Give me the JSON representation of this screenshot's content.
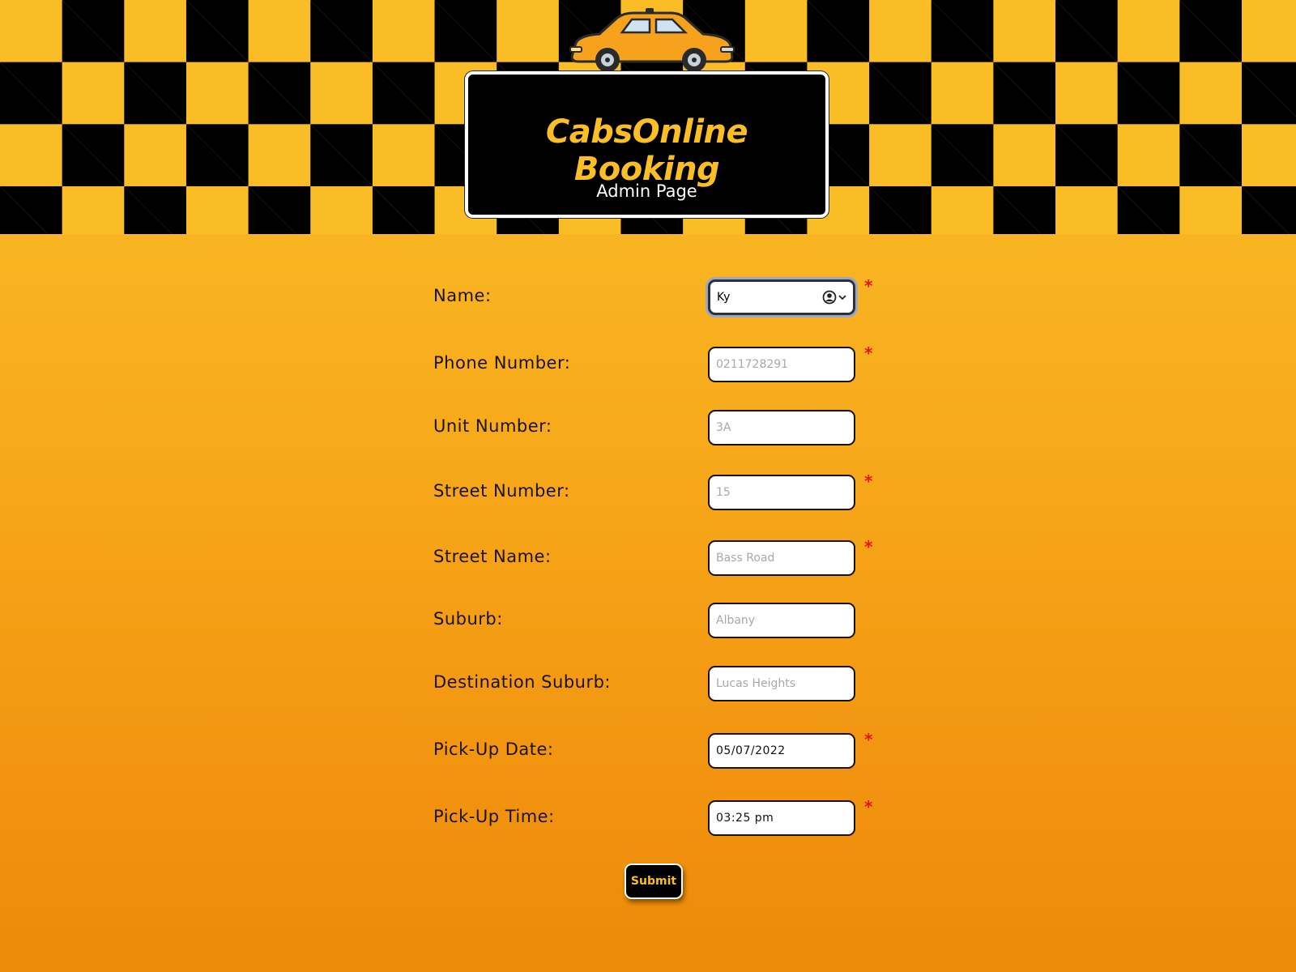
{
  "header": {
    "title": "CabsOnline Booking",
    "subtitle": "Admin Page"
  },
  "colors": {
    "accent": "#fbbf25",
    "required": "#e8141a",
    "background_top": "#fcc22a",
    "background_bottom": "#ec8a0a"
  },
  "icons": {
    "logo": "taxi-car-icon",
    "autofill": "contact-autofill-icon",
    "required_marker": "asterisk"
  },
  "form": {
    "required_marker": "*",
    "fields": [
      {
        "key": "name",
        "label": "Name:",
        "value": "Ky",
        "placeholder": "",
        "required": true,
        "focused": true
      },
      {
        "key": "phone",
        "label": "Phone Number:",
        "value": "",
        "placeholder": "0211728291",
        "required": true
      },
      {
        "key": "unit",
        "label": "Unit Number:",
        "value": "",
        "placeholder": "3A",
        "required": false
      },
      {
        "key": "street_number",
        "label": "Street Number:",
        "value": "",
        "placeholder": "15",
        "required": true
      },
      {
        "key": "street_name",
        "label": "Street Name:",
        "value": "",
        "placeholder": "Bass Road",
        "required": true
      },
      {
        "key": "suburb",
        "label": "Suburb:",
        "value": "",
        "placeholder": "Albany",
        "required": false
      },
      {
        "key": "destination_suburb",
        "label": "Destination Suburb:",
        "value": "",
        "placeholder": "Lucas Heights",
        "required": false
      },
      {
        "key": "pickup_date",
        "label": "Pick-Up Date:",
        "value": "05/07/2022",
        "placeholder": "",
        "required": true
      },
      {
        "key": "pickup_time",
        "label": "Pick-Up Time:",
        "value": "03:25 pm",
        "placeholder": "",
        "required": true
      }
    ],
    "submit_label": "Submit"
  }
}
